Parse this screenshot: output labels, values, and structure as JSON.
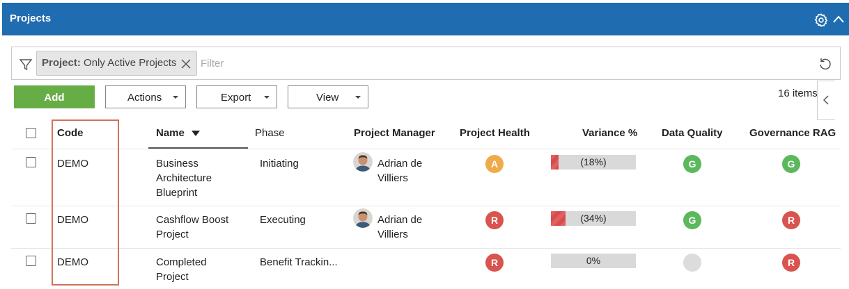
{
  "panel": {
    "title": "Projects"
  },
  "filter": {
    "chip_key": "Project:",
    "chip_value": "Only Active Projects",
    "placeholder": "Filter"
  },
  "toolbar": {
    "add_label": "Add",
    "actions_label": "Actions",
    "export_label": "Export",
    "view_label": "View",
    "count_label": "16 items"
  },
  "columns": {
    "code": "Code",
    "name": "Name",
    "phase": "Phase",
    "manager": "Project Manager",
    "health": "Project Health",
    "variance": "Variance %",
    "quality": "Data Quality",
    "governance": "Governance RAG"
  },
  "rows": [
    {
      "code": "DEMO",
      "name_lines": [
        "Business",
        "Architecture",
        "Blueprint"
      ],
      "phase": "Initiating",
      "manager_lines": [
        "Adrian de",
        "Villiers"
      ],
      "health": "A",
      "variance_text": "(18%)",
      "variance_fill": 0.18,
      "quality": "G",
      "governance": "G"
    },
    {
      "code": "DEMO",
      "name_lines": [
        "Cashflow Boost",
        "Project"
      ],
      "phase": "Executing",
      "manager_lines": [
        "Adrian de",
        "Villiers"
      ],
      "health": "R",
      "variance_text": "(34%)",
      "variance_fill": 0.34,
      "quality": "G",
      "governance": "R"
    },
    {
      "code": "DEMO",
      "name_lines": [
        "Completed",
        "Project"
      ],
      "phase": "Benefit Trackin...",
      "manager_lines": [
        "",
        ""
      ],
      "health": "R",
      "variance_text": "0%",
      "variance_fill": 0,
      "quality": "",
      "governance": "R"
    }
  ],
  "rag_colors": {
    "A": "#efab4a",
    "G": "#5cb85c",
    "R": "#d9534f",
    "none": "#dcdcdc"
  }
}
